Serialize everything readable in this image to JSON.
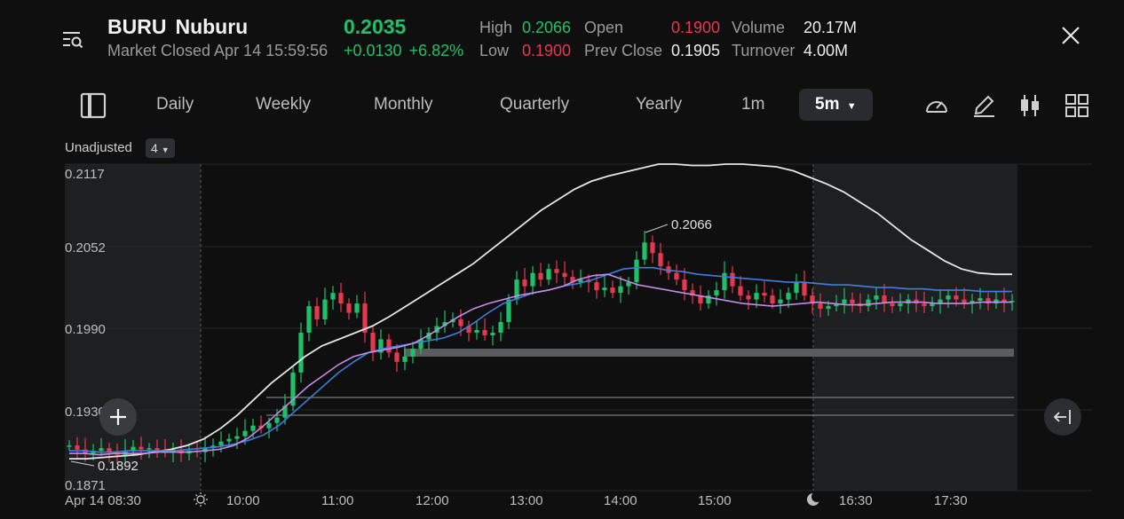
{
  "header": {
    "symbol": "BURU",
    "name": "Nuburu",
    "status": "Market Closed Apr 14 15:59:56",
    "price": "0.2035",
    "change": "+0.0130",
    "change_pct": "+6.82%",
    "stats": {
      "high_label": "High",
      "high": "0.2066",
      "low_label": "Low",
      "low": "0.1900",
      "open_label": "Open",
      "open": "0.1900",
      "prev_close_label": "Prev Close",
      "prev_close": "0.1905",
      "volume_label": "Volume",
      "volume": "20.17M",
      "turnover_label": "Turnover",
      "turnover": "4.00M"
    }
  },
  "toolbar": {
    "periods": [
      "Daily",
      "Weekly",
      "Monthly",
      "Quarterly",
      "Yearly",
      "1m"
    ],
    "active": "5m"
  },
  "chart_options": {
    "adjust": "Unadjusted",
    "indicator_count": "4"
  },
  "colors": {
    "up": "#20c06a",
    "down": "#e8384f",
    "ma_blue": "#3d7fe0",
    "ma_violet": "#c58be8",
    "boll": "#e6e6e6"
  },
  "chart_data": {
    "type": "candlestick",
    "y_ticks": [
      "0.2117",
      "0.2052",
      "0.1990",
      "0.1930",
      "0.1871"
    ],
    "x_ticks": [
      "Apr 14 08:30",
      "10:00",
      "11:00",
      "12:00",
      "13:00",
      "14:00",
      "15:00",
      "16:30",
      "17:30"
    ],
    "ylim": [
      0.1871,
      0.2117
    ],
    "annotations": {
      "max": "0.2066",
      "min": "0.1892"
    },
    "close_series": [
      0.1905,
      0.1902,
      0.1899,
      0.1901,
      0.1903,
      0.19,
      0.1898,
      0.1901,
      0.1904,
      0.1902,
      0.1903,
      0.1901,
      0.19,
      0.1902,
      0.1899,
      0.1901,
      0.19,
      0.1903,
      0.1905,
      0.1908,
      0.191,
      0.1912,
      0.1916,
      0.192,
      0.1918,
      0.1922,
      0.1926,
      0.1935,
      0.196,
      0.199,
      0.201,
      0.2,
      0.2015,
      0.202,
      0.2012,
      0.2005,
      0.2012,
      0.199,
      0.1975,
      0.1985,
      0.1975,
      0.1968,
      0.1972,
      0.1978,
      0.1985,
      0.199,
      0.1995,
      0.1998,
      0.2,
      0.1995,
      0.199,
      0.1992,
      0.1988,
      0.199,
      0.1998,
      0.2015,
      0.203,
      0.2025,
      0.2035,
      0.203,
      0.2038,
      0.2035,
      0.2032,
      0.2028,
      0.203,
      0.2028,
      0.2022,
      0.2024,
      0.202,
      0.2025,
      0.2028,
      0.2045,
      0.2058,
      0.205,
      0.204,
      0.2035,
      0.203,
      0.2022,
      0.2018,
      0.2012,
      0.2018,
      0.2022,
      0.2035,
      0.2025,
      0.2018,
      0.2015,
      0.202,
      0.2018,
      0.2012,
      0.2015,
      0.202,
      0.2028,
      0.2018,
      0.2012,
      0.2008,
      0.201,
      0.2012,
      0.2015,
      0.2012,
      0.201,
      0.2015,
      0.2018,
      0.2012,
      0.201,
      0.2012,
      0.2015,
      0.2012,
      0.201,
      0.2012,
      0.2015,
      0.2018,
      0.2015,
      0.2012,
      0.2014,
      0.2016,
      0.2012,
      0.2015,
      0.2013,
      0.2014
    ],
    "ma_blue": [
      0.1901,
      0.1901,
      0.19,
      0.19,
      0.1901,
      0.1901,
      0.1901,
      0.1901,
      0.1902,
      0.1903,
      0.1904,
      0.1906,
      0.1909,
      0.1913,
      0.192,
      0.193,
      0.194,
      0.195,
      0.196,
      0.1968,
      0.1975,
      0.1978,
      0.198,
      0.1982,
      0.1984,
      0.1986,
      0.199,
      0.1997,
      0.2005,
      0.2012,
      0.2016,
      0.202,
      0.2022,
      0.2025,
      0.2027,
      0.203,
      0.2034,
      0.2038,
      0.2039,
      0.2039,
      0.2037,
      0.2036,
      0.2034,
      0.2033,
      0.2032,
      0.2031,
      0.203,
      0.2029,
      0.2028,
      0.2028,
      0.2027,
      0.2026,
      0.2026,
      0.2025,
      0.2024,
      0.2024,
      0.2023,
      0.2023,
      0.2022,
      0.2022,
      0.2022,
      0.2021,
      0.2021,
      0.2021
    ],
    "ma_violet": [
      0.1899,
      0.1899,
      0.1898,
      0.1899,
      0.1899,
      0.1899,
      0.19,
      0.19,
      0.19,
      0.1901,
      0.1902,
      0.1905,
      0.1911,
      0.192,
      0.193,
      0.194,
      0.195,
      0.1958,
      0.1966,
      0.1972,
      0.1975,
      0.1977,
      0.1979,
      0.1982,
      0.1988,
      0.1995,
      0.2002,
      0.2008,
      0.2012,
      0.2015,
      0.2018,
      0.202,
      0.2022,
      0.2025,
      0.203,
      0.2033,
      0.2034,
      0.203,
      0.2026,
      0.2024,
      0.2022,
      0.202,
      0.2018,
      0.2016,
      0.2014,
      0.2012,
      0.2011,
      0.201,
      0.2011,
      0.2012,
      0.2013,
      0.2012,
      0.2011,
      0.2011,
      0.2012,
      0.2013,
      0.2013,
      0.2013,
      0.2012,
      0.2012,
      0.2012,
      0.2013,
      0.2013,
      0.2013
    ],
    "boll_upper": [
      0.1895,
      0.1895,
      0.1896,
      0.1897,
      0.1898,
      0.19,
      0.1902,
      0.1905,
      0.191,
      0.1918,
      0.1928,
      0.194,
      0.1952,
      0.1962,
      0.1972,
      0.198,
      0.1985,
      0.199,
      0.1995,
      0.2002,
      0.201,
      0.2018,
      0.2026,
      0.2034,
      0.2042,
      0.2052,
      0.2062,
      0.2072,
      0.2082,
      0.209,
      0.2098,
      0.2104,
      0.2108,
      0.2111,
      0.2114,
      0.2117,
      0.2117,
      0.2116,
      0.2116,
      0.2117,
      0.2117,
      0.2116,
      0.2115,
      0.2112,
      0.2107,
      0.2102,
      0.2096,
      0.2088,
      0.208,
      0.207,
      0.206,
      0.2052,
      0.2044,
      0.2038,
      0.2035,
      0.2034,
      0.2034
    ]
  }
}
